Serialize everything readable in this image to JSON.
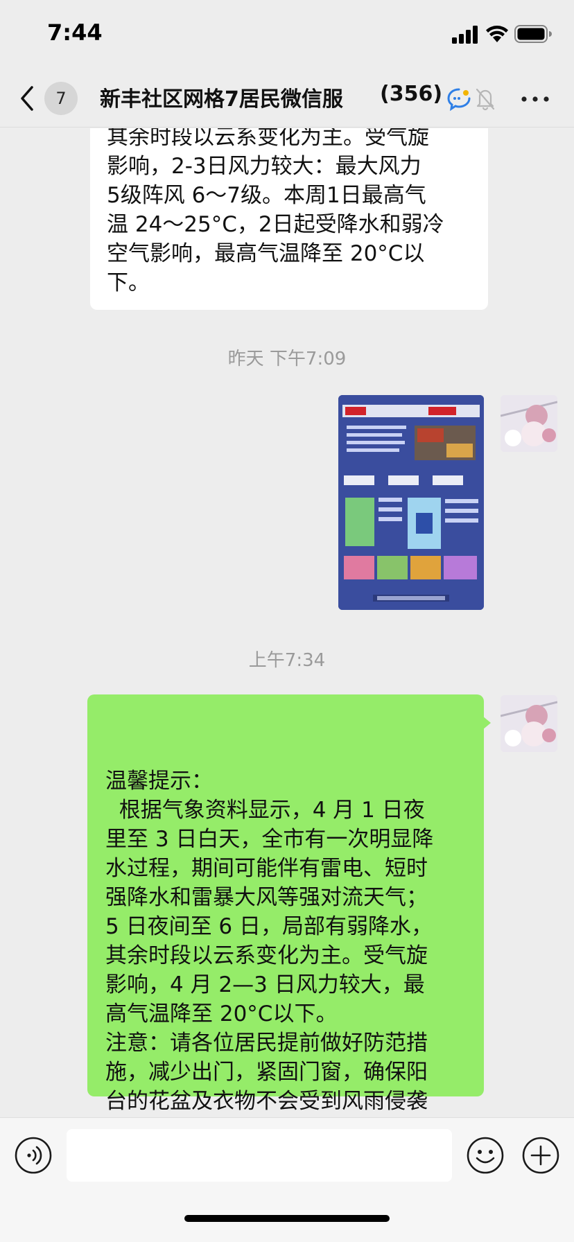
{
  "status_bar": {
    "time": "7:44"
  },
  "nav": {
    "unread_count": "7",
    "title": "新丰社区网格7居民微信服",
    "member_count": "(356)"
  },
  "messages": {
    "partial_text": "其余时段以云系变化为主。受气旋\n影响，2-3日风力较大：最大风力\n5级阵风 6～7级。本周1日最高气\n温 24～25°C，2日起受降水和弱冷\n空气影响，最高气温降至 20°C以\n下。",
    "timestamp_1": "昨天 下午7:09",
    "timestamp_2": "上午7:34",
    "green_text": "温馨提示：\n  根据气象资料显示，4 月 1 日夜\n里至 3 日白天，全市有一次明显降\n水过程，期间可能伴有雷电、短时\n强降水和雷暴大风等强对流天气；\n5 日夜间至 6 日，局部有弱降水，\n其余时段以云系变化为主。受气旋\n影响，4 月 2—3 日风力较大，最\n高气温降至 20°C以下。\n注意：请各位居民提前做好防范措\n施，减少出门，紧固门窗，确保阳\n台的花盆及衣物不会受到风雨侵袭",
    "emoji_icons": [
      "folded-hands-icon",
      "folded-hands-icon",
      "folded-hands-icon"
    ]
  },
  "colors": {
    "background": "#ededed",
    "bubble_green": "#95ec69",
    "bubble_white": "#ffffff",
    "poster_blue": "#3a4d9e"
  }
}
